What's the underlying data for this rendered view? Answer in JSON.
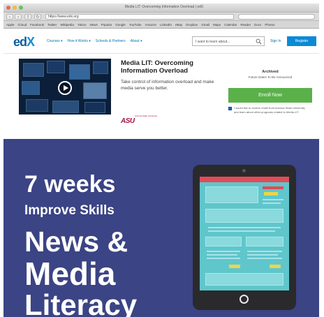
{
  "browser": {
    "window_title": "Media LIT: Overcoming Information Overload | edX",
    "url": "https://www.edx.org",
    "bookmarks": [
      "Apple",
      "iCloud",
      "Facebook",
      "Twitter",
      "Wikipedia",
      "Yahoo",
      "News",
      "Popular",
      "Google",
      "YouTube",
      "Amazon",
      "LinkedIn",
      "eBay",
      "Dropbox",
      "Gmail",
      "Maps",
      "Calendar",
      "Reader",
      "Docs",
      "Photos"
    ]
  },
  "header": {
    "logo": {
      "main": "ed",
      "accent": "X"
    },
    "nav": [
      "Courses ▾",
      "How it Works ▾",
      "Schools & Partners",
      "About ▾"
    ],
    "search_placeholder": "I want to learn about...",
    "signin_label": "Sign In",
    "register_label": "Register"
  },
  "course": {
    "title": "Media LIT: Overcoming Information Overload",
    "description": "Take control of information overload and make media serve you better.",
    "school_logo": "ASU",
    "school_name": "Arizona State University",
    "status": "Archived",
    "status_sub": "Future Dates To Be Announced",
    "enroll_label": "Enroll Now",
    "verify_text": "I would like to receive email from Arizona State University and learn about other programs related to Media LIT."
  },
  "promo": {
    "line1": "7 weeks",
    "line2": "Improve Skills",
    "line3": "News &",
    "line4": "Media",
    "line5": "Literacy"
  },
  "colors": {
    "brand_blue": "#0075b4",
    "register_blue": "#0a8ad6",
    "enroll_green": "#5ab14a",
    "promo_bg": "#3b4484",
    "asu_maroon": "#a4123f"
  },
  "icons": {
    "search": "search-icon",
    "play": "play-icon",
    "tablet_home": "home-button-icon"
  }
}
